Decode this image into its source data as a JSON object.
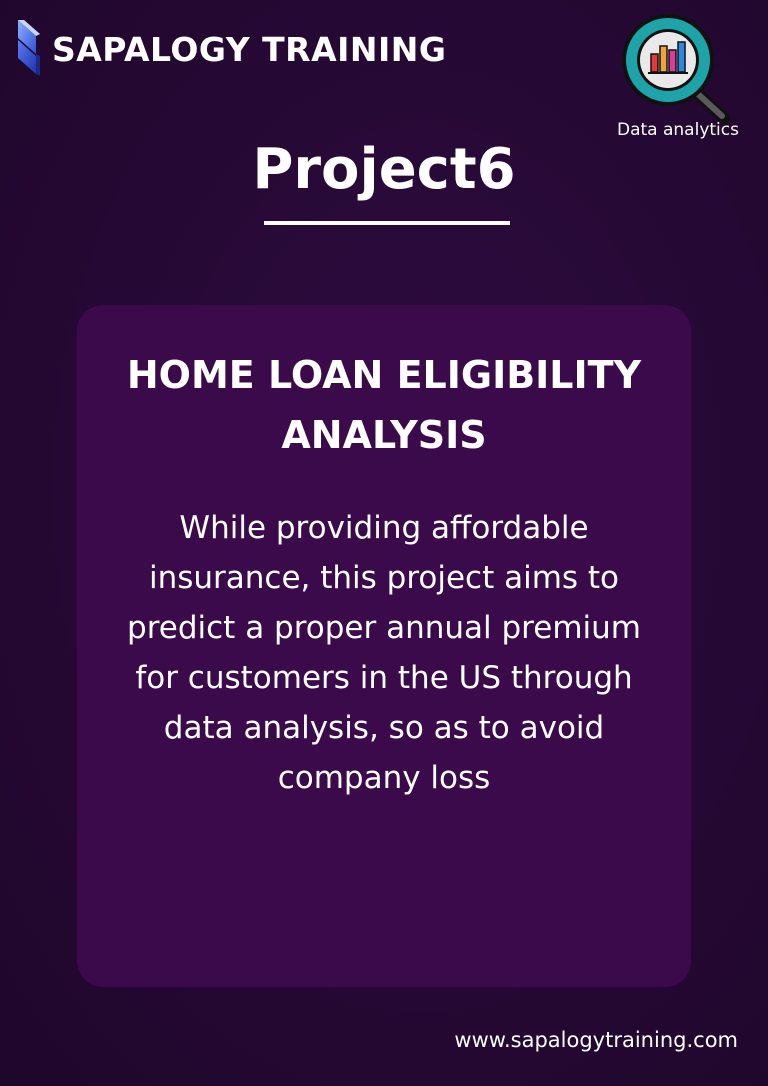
{
  "brand": {
    "name": "SAPALOGY TRAINING",
    "logo_icon": "blue-faceted-s-logo"
  },
  "badge": {
    "icon": "magnifier-bar-chart-icon",
    "label": "Data analytics"
  },
  "project": {
    "title": "Project6"
  },
  "card": {
    "title": "HOME LOAN ELIGIBILITY ANALYSIS",
    "description": "While providing affordable insurance, this project aims to predict a proper annual premium for customers in the US through data analysis, so as to avoid company loss"
  },
  "footer": {
    "website": "www.sapalogytraining.com"
  },
  "colors": {
    "background": "#2a0a3a",
    "card": "#3a0a4a",
    "text": "#ffffff",
    "logo_blue": "#3b5bdb",
    "badge_teal": "#1ea3a8"
  }
}
